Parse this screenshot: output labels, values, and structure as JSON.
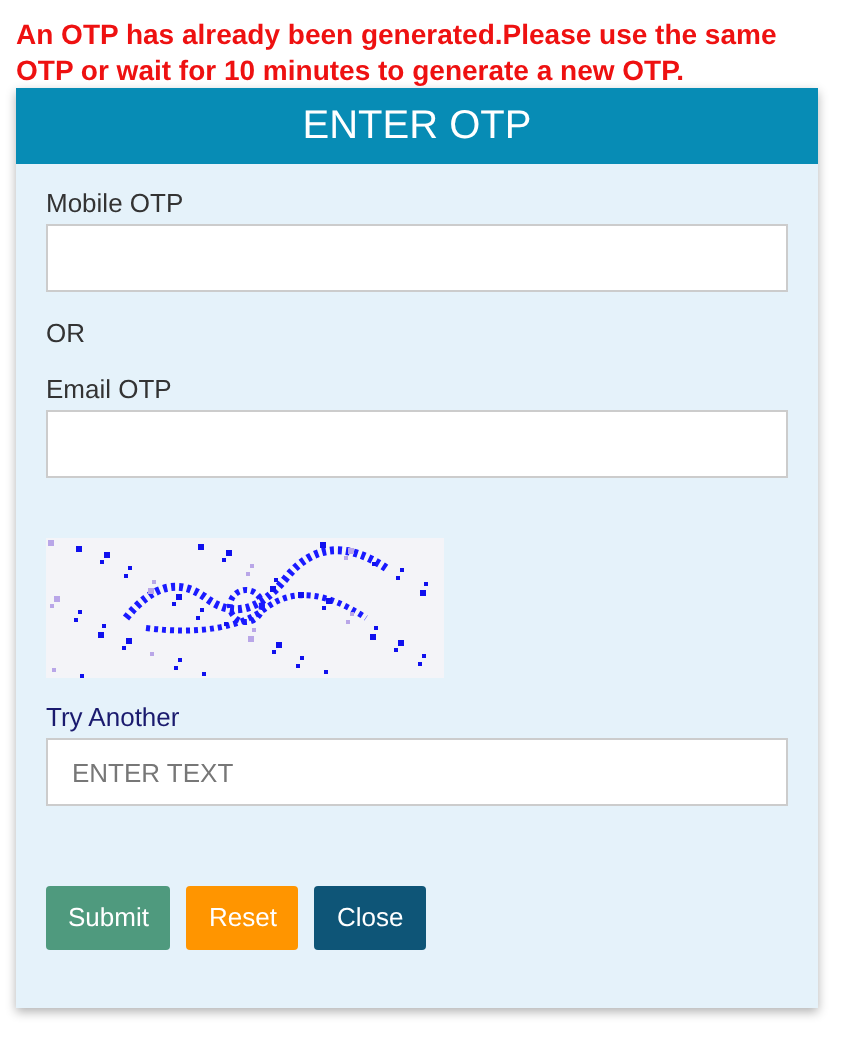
{
  "message": "An OTP has already been generated.Please use the same OTP or wait for 10 minutes to generate a new OTP.",
  "panel": {
    "title": "ENTER OTP"
  },
  "fields": [
    {
      "label": "Mobile OTP"
    },
    {
      "label": "Email OTP"
    }
  ],
  "separator": "OR",
  "captcha": {
    "kind": "picture",
    "link": "Try Another",
    "placeholder": "ENTER TEXT"
  },
  "buttons": [
    {
      "label": "Submit",
      "color": "#4f9a7e"
    },
    {
      "label": "Reset",
      "color": "#ff9500"
    },
    {
      "label": "Close",
      "color": "#0e5577"
    }
  ]
}
